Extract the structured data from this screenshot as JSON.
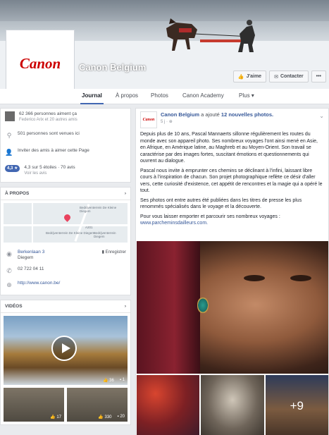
{
  "page": {
    "name": "Canon Belgium",
    "logo_text": "Canon"
  },
  "cover_buttons": {
    "like_label": "J'aime",
    "contact_label": "Contacter",
    "more_label": "•••"
  },
  "tabs": [
    {
      "label": "Journal",
      "active": true
    },
    {
      "label": "À propos",
      "active": false
    },
    {
      "label": "Photos",
      "active": false
    },
    {
      "label": "Canon Academy",
      "active": false
    },
    {
      "label": "Plus ▾",
      "active": false
    }
  ],
  "sidebar": {
    "likes_text": "62 366 personnes aiment ça",
    "likes_sub": "Federico Arix et 20 autres amis",
    "checkins_text": "501 personnes sont venues ici",
    "invite_text": "Inviter des amis à aimer cette Page",
    "rating_badge": "4,3 ★",
    "rating_text": "4,3 sur 5 étoiles · 70 avis",
    "rating_link": "Voir les avis",
    "about_title": "À PROPOS",
    "map_labels": [
      "Bedrijventerrein De Kleine Diegem",
      "Bedrijventerrein De Kleine Diegem",
      "Bedrijventerrein Diegem",
      "A201"
    ],
    "address_line1": "Berkenlaan 3",
    "address_line2": "Diegem",
    "save_label": "Enregistrer",
    "phone": "02 722 04 11",
    "website": "http://www.canon.be/",
    "videos_title": "VIDÉOS",
    "video_main_stats": {
      "likes": "36",
      "comments": "1"
    },
    "video_small": [
      {
        "likes": "17"
      },
      {
        "likes": "330",
        "comments": "20"
      }
    ]
  },
  "post": {
    "author": "Canon Belgium",
    "verb": "a ajouté",
    "photos_link": "12 nouvelles photos.",
    "time": "5 j ·",
    "paragraphs": [
      "Depuis plus de 10 ans, Pascal Mannaerts sillonne régulièrement les routes du monde avec son appareil photo. Ses nombreux voyages l'ont ainsi mené en Asie, en Afrique, en Amérique latine, au Maghreb et au Moyen-Orient. Son travail se caractérise par des images fortes, suscitant émotions et questionnements qui ouvrent au dialogue.",
      "Pascal nous invite à emprunter ces chemins se déclinant à l'infini, laissant libre cours à l'inspiration de chacun. Son projet photographique reflète ce désir d'aller vers, cette curiosité d'existence, cet appétit de rencontres et la magie qui a opéré le tout.",
      "Ses photos ont entre autres été publiées dans les titres de presse les plus renommés spécialisés dans le voyage et la découverte.",
      "Pour vous laisser emporter et parcourir ses nombreux voyages :"
    ],
    "link": "www.parcheminsdailleurs.com.",
    "more_photos": "+9"
  }
}
